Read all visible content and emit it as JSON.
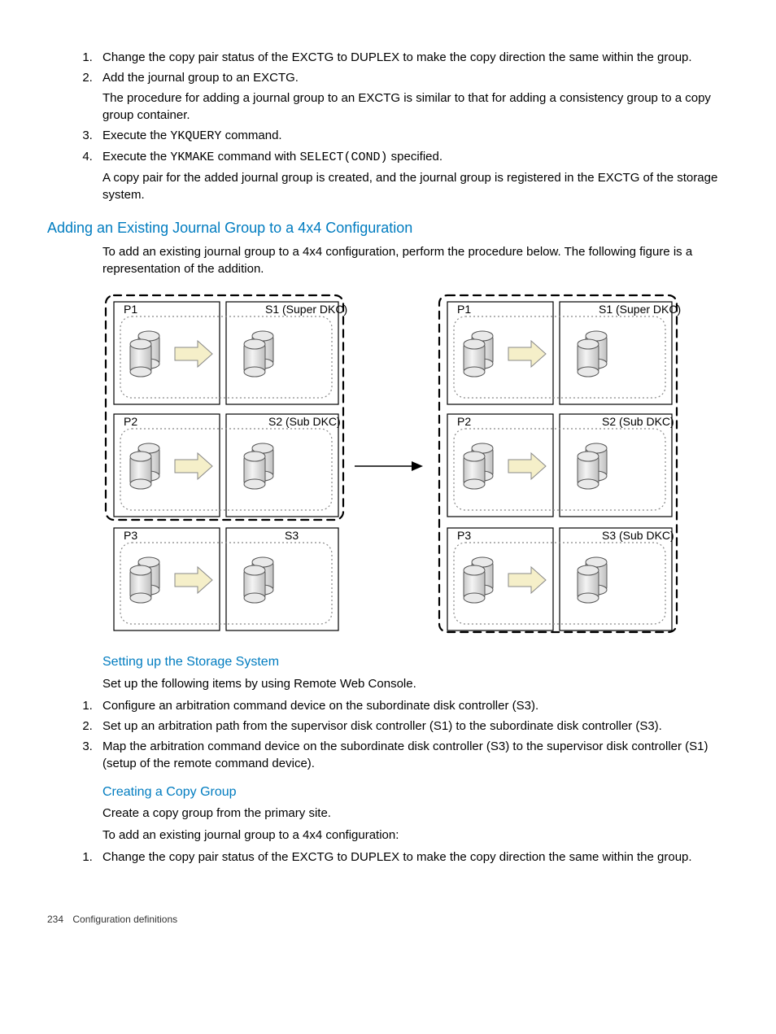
{
  "list1": {
    "i1": {
      "text": "Change the copy pair status of the EXCTG to DUPLEX to make the copy direction the same within the group."
    },
    "i2": {
      "text": "Add the journal group to an EXCTG.",
      "sub": "The procedure for adding a journal group to an EXCTG is similar to that for adding a consistency group to a copy group container."
    },
    "i3": {
      "prefix": "Execute the ",
      "cmd": "YKQUERY",
      "suffix": " command."
    },
    "i4": {
      "prefix": "Execute the ",
      "cmd": "YKMAKE",
      "mid": " command with ",
      "cmd2": "SELECT(COND)",
      "suffix": " specified.",
      "sub": "A copy pair for the added journal group is created, and the journal group is registered in the EXCTG of the storage system."
    }
  },
  "sec_add": "Adding an Existing Journal Group to a 4x4 Configuration",
  "para_add": "To add an existing journal group to a 4x4 configuration, perform the procedure below. The following figure is a representation of the addition.",
  "figure_labels": {
    "P1": "P1",
    "P2": "P2",
    "P3": "P3",
    "S1": "S1 (Super DKC)",
    "S2": "S2 (Sub DKC)",
    "S3a": "S3",
    "S3b": "S3 (Sub DKC)"
  },
  "sec_storage": "Setting up the Storage System",
  "para_storage": "Set up the following items by using Remote Web Console.",
  "list2": {
    "i1": "Configure an arbitration command device on the subordinate disk controller (S3).",
    "i2": "Set up an arbitration path from the supervisor disk controller (S1) to the subordinate disk controller (S3).",
    "i3": "Map the arbitration command device on the subordinate disk controller (S3) to the supervisor disk controller (S1) (setup of the remote command device)."
  },
  "sec_copy": "Creating a Copy Group",
  "para_copy1": "Create a copy group from the primary site.",
  "para_copy2": "To add an existing journal group to a 4x4 configuration:",
  "list3": {
    "i1": "Change the copy pair status of the EXCTG to DUPLEX to make the copy direction the same within the group."
  },
  "footer": {
    "page": "234",
    "section": "Configuration definitions"
  }
}
